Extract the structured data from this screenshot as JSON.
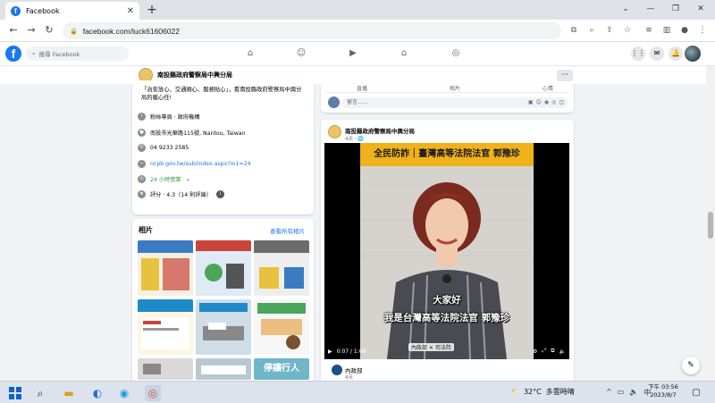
{
  "browser": {
    "tab_title": "Facebook",
    "new_tab": "+",
    "url": "facebook.com/luck61606022",
    "window_controls": [
      "⌄",
      "—",
      "❐",
      "✕"
    ]
  },
  "fb": {
    "logo": "f",
    "search_placeholder": "搜尋 Facebook",
    "nav_icons": [
      "home-icon",
      "friends-icon",
      "watch-icon",
      "marketplace-icon",
      "groups-icon"
    ],
    "right_icons": [
      "menu-icon",
      "messenger-icon",
      "bell-icon"
    ]
  },
  "page": {
    "name": "南投縣政府警察局中興分局",
    "more_label": "···"
  },
  "intro": {
    "description": "「治安放心、交通順心、服務貼心」，看南投縣政府警察局中興分局的暖心任!",
    "rows": [
      {
        "icon": "info-icon",
        "text": "粉絲專頁 · 政府機構"
      },
      {
        "icon": "location-icon",
        "text": "南投市光華路115號, Nantou, Taiwan"
      },
      {
        "icon": "phone-icon",
        "text": "04 9233 2585"
      },
      {
        "icon": "link-icon",
        "text": "ncpb.gov.tw/sub/index.aspx?m1=24"
      },
      {
        "icon": "clock-icon",
        "text": "24 小時營業"
      },
      {
        "icon": "star-icon",
        "text": "評分 · 4.3（14 則評論）"
      }
    ]
  },
  "photos": {
    "title": "相片",
    "see_all": "查看所有相片",
    "thumb_colors": [
      "#3b7bc4",
      "#c9443a",
      "#e8c23e",
      "#1f8ac9",
      "#4aa65a",
      "#e49a31",
      "#d9d9d9",
      "#5aa1d6",
      "#6fb6c8"
    ]
  },
  "compose": {
    "actions": [
      "直播",
      "相片",
      "心情"
    ],
    "placeholder": "留言……"
  },
  "post": {
    "author": "南投縣政府警察局中興分局",
    "meta": "4天 · 🌐",
    "video": {
      "banner": "全民防詐｜臺灣高等法院法官 郭豫珍",
      "subtitle_1": "大家好",
      "subtitle_2": "我是台灣高等法院法官 郭豫珍",
      "time": "0:07 / 1:08",
      "watermark": "內政部 ✕ 司法院"
    },
    "shared_from": "內政部",
    "shared_meta": "4天"
  },
  "taskbar": {
    "weather_temp": "32°C",
    "weather_text": "多雲時晴",
    "time": "下午 03:56",
    "date": "2023/8/7",
    "ime": "中"
  }
}
